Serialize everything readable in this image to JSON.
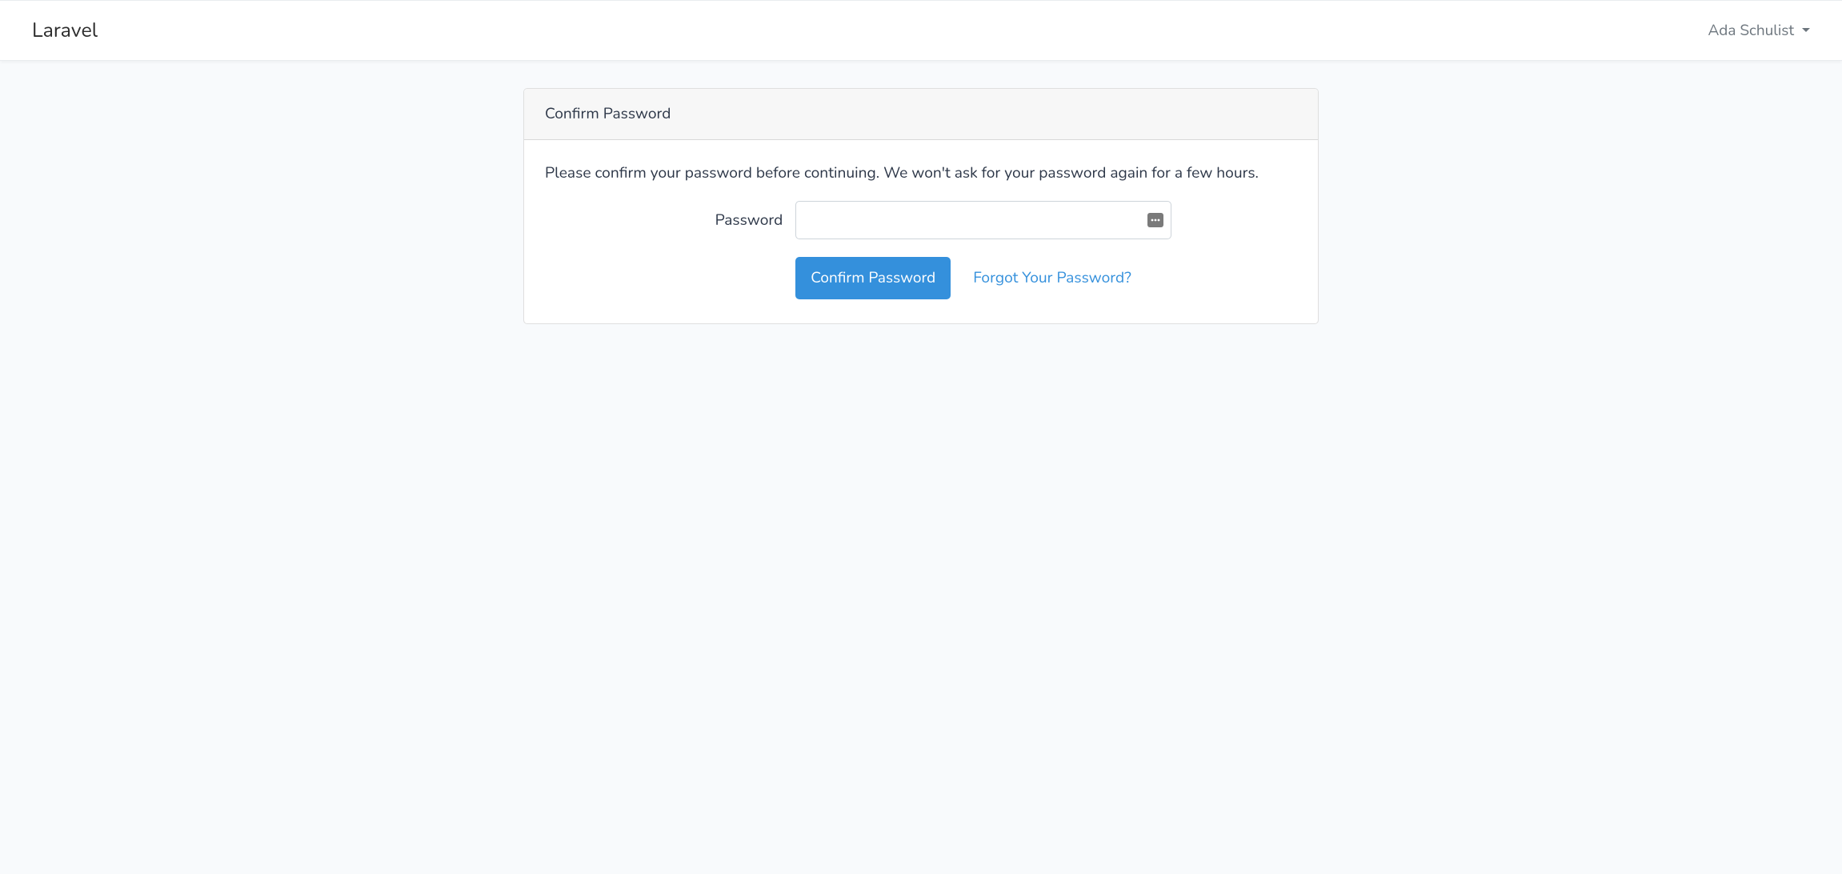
{
  "navbar": {
    "brand": "Laravel",
    "user_name": "Ada Schulist"
  },
  "card": {
    "header": "Confirm Password",
    "message": "Please confirm your password before continuing. We won't ask for your password again for a few hours.",
    "password_label": "Password",
    "password_value": "",
    "confirm_button": "Confirm Password",
    "forgot_link": "Forgot Your Password?"
  }
}
